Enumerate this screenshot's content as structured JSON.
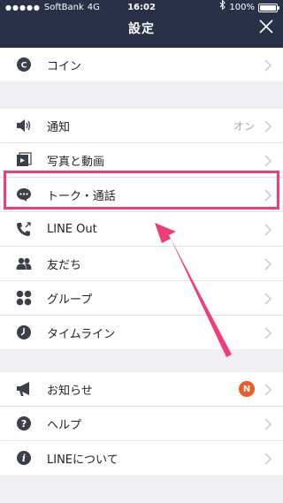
{
  "status_bar": {
    "carrier": "SoftBank",
    "network": "4G",
    "time": "16:02",
    "battery": "100%"
  },
  "header": {
    "title": "設定"
  },
  "groups": [
    {
      "items": [
        {
          "label": "コイン",
          "icon": "coin-icon"
        }
      ]
    },
    {
      "items": [
        {
          "label": "通知",
          "icon": "speaker-icon",
          "value": "オン"
        },
        {
          "label": "写真と動画",
          "icon": "photo-video-icon"
        },
        {
          "label": "トーク・通話",
          "icon": "chat-bubble-icon"
        },
        {
          "label": "LINE Out",
          "icon": "phone-out-icon"
        },
        {
          "label": "友だち",
          "icon": "friends-icon"
        },
        {
          "label": "グループ",
          "icon": "group-icon"
        },
        {
          "label": "タイムライン",
          "icon": "timeline-clock-icon"
        }
      ]
    },
    {
      "items": [
        {
          "label": "お知らせ",
          "icon": "megaphone-icon",
          "badge": "N"
        },
        {
          "label": "ヘルプ",
          "icon": "help-icon"
        },
        {
          "label": "LINEについて",
          "icon": "info-icon"
        }
      ]
    }
  ],
  "colors": {
    "header_bg": "#283147",
    "highlight": "#f13c7a",
    "badge": "#ef5b25",
    "background": "#efeff4"
  }
}
